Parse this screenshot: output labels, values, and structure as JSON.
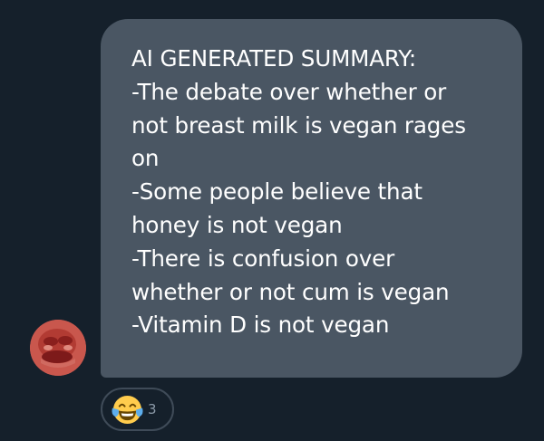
{
  "message": {
    "lines": [
      "AI GENERATED SUMMARY:",
      "-The debate over whether or",
      "not breast milk is vegan rages",
      "on",
      "-Some people believe that",
      "honey is not vegan",
      "-There is confusion over",
      "whether or not cum is vegan",
      "-Vitamin D is not vegan"
    ]
  },
  "reaction": {
    "emoji_icon": "face-with-tears-of-joy-icon",
    "count": "3"
  },
  "colors": {
    "background": "#15202b",
    "bubble": "#4a5663",
    "text": "#ffffff",
    "reaction_border": "#3f4b58",
    "avatar": "#c75a52"
  }
}
